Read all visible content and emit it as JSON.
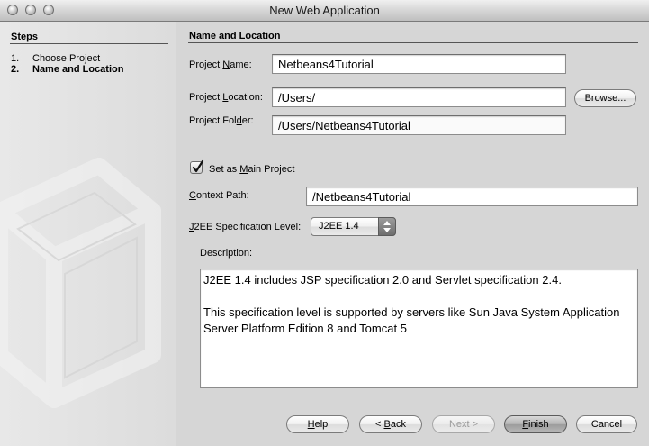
{
  "window": {
    "title": "New Web Application"
  },
  "steps": {
    "header": "Steps",
    "items": [
      {
        "num": "1.",
        "label": "Choose Project",
        "current": false
      },
      {
        "num": "2.",
        "label": "Name and Location",
        "current": true
      }
    ]
  },
  "form": {
    "section_title": "Name and Location",
    "project_name": {
      "label_pre": "Project ",
      "label_key": "N",
      "label_post": "ame:",
      "value": "Netbeans4Tutorial"
    },
    "project_location": {
      "label_pre": "Project ",
      "label_key": "L",
      "label_post": "ocation:",
      "value": "/Users/"
    },
    "project_folder": {
      "label_pre": "Project Fol",
      "label_key": "d",
      "label_post": "er:",
      "value": "/Users/Netbeans4Tutorial"
    },
    "browse_label": "Browse...",
    "main_project": {
      "label_pre": "Set as ",
      "label_key": "M",
      "label_post": "ain Project",
      "checked": true
    },
    "context_path": {
      "label_pre": "",
      "label_key": "C",
      "label_post": "ontext Path:",
      "value": "/Netbeans4Tutorial"
    },
    "spec_level": {
      "label_pre": "",
      "label_key": "J",
      "label_post": "2EE Specification Level:",
      "value": "J2EE 1.4"
    },
    "description": {
      "label": "Description:",
      "para1": "J2EE 1.4 includes JSP specification 2.0 and Servlet specification 2.4.",
      "para2": "This specification level is supported by servers like Sun Java System Application Server Platform Edition 8 and Tomcat 5"
    }
  },
  "buttons": {
    "help": {
      "pre": "",
      "key": "H",
      "post": "elp"
    },
    "back": {
      "pre": "< ",
      "key": "B",
      "post": "ack"
    },
    "next": {
      "label": "Next >"
    },
    "finish": {
      "pre": "",
      "key": "F",
      "post": "inish"
    },
    "cancel": {
      "label": "Cancel"
    }
  },
  "icons": {
    "checkmark": "checkmark-icon",
    "select_arrows": "up-down-arrows-icon"
  }
}
